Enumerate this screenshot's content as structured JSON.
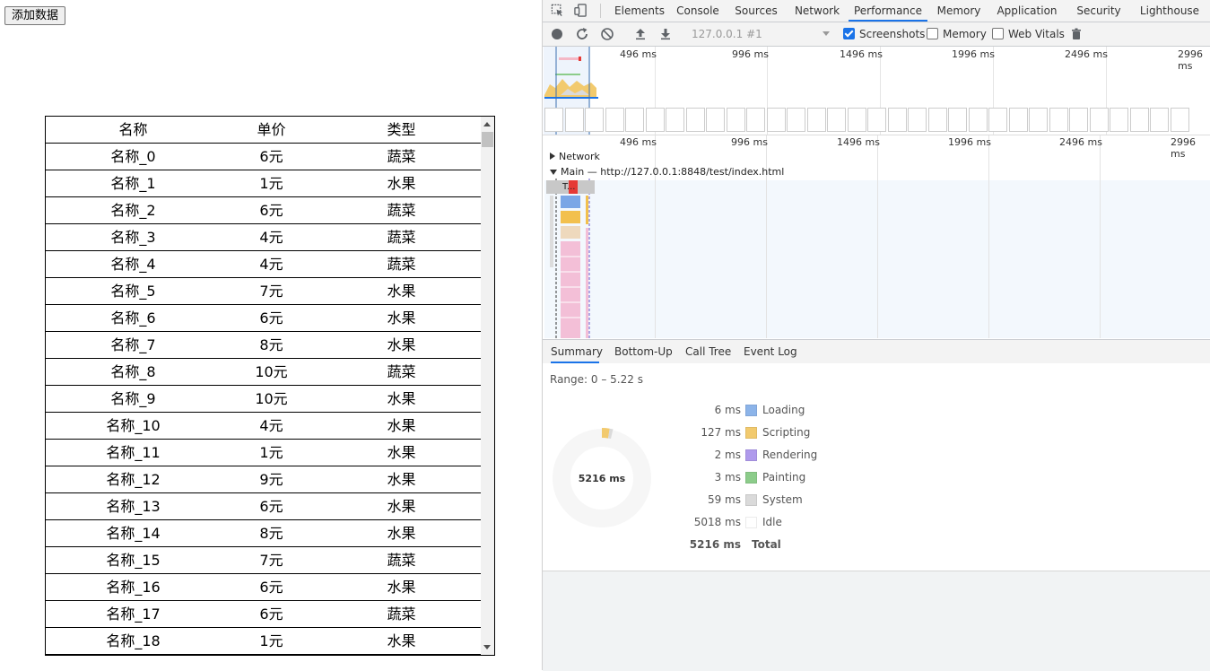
{
  "page": {
    "add_button": "添加数据"
  },
  "table": {
    "headers": [
      "名称",
      "单价",
      "类型"
    ],
    "rows": [
      [
        "名称_0",
        "6元",
        "蔬菜"
      ],
      [
        "名称_1",
        "1元",
        "水果"
      ],
      [
        "名称_2",
        "6元",
        "蔬菜"
      ],
      [
        "名称_3",
        "4元",
        "蔬菜"
      ],
      [
        "名称_4",
        "4元",
        "蔬菜"
      ],
      [
        "名称_5",
        "7元",
        "水果"
      ],
      [
        "名称_6",
        "6元",
        "水果"
      ],
      [
        "名称_7",
        "8元",
        "水果"
      ],
      [
        "名称_8",
        "10元",
        "蔬菜"
      ],
      [
        "名称_9",
        "10元",
        "水果"
      ],
      [
        "名称_10",
        "4元",
        "水果"
      ],
      [
        "名称_11",
        "1元",
        "水果"
      ],
      [
        "名称_12",
        "9元",
        "水果"
      ],
      [
        "名称_13",
        "6元",
        "水果"
      ],
      [
        "名称_14",
        "8元",
        "水果"
      ],
      [
        "名称_15",
        "7元",
        "蔬菜"
      ],
      [
        "名称_16",
        "6元",
        "水果"
      ],
      [
        "名称_17",
        "6元",
        "蔬菜"
      ],
      [
        "名称_18",
        "1元",
        "水果"
      ]
    ]
  },
  "devtools": {
    "tabs": [
      "Elements",
      "Console",
      "Sources",
      "Network",
      "Performance",
      "Memory",
      "Application",
      "Security",
      "Lighthouse"
    ],
    "active_tab": "Performance",
    "toolbar": {
      "recording_select": "127.0.0.1 #1",
      "screenshots_label": "Screenshots",
      "screenshots_checked": true,
      "memory_label": "Memory",
      "memory_checked": false,
      "webvitals_label": "Web Vitals",
      "webvitals_checked": false
    },
    "overview_ticks": [
      "496 ms",
      "996 ms",
      "1496 ms",
      "1996 ms",
      "2496 ms",
      "2996 ms"
    ],
    "timeline_ticks": [
      "496 ms",
      "996 ms",
      "1496 ms",
      "1996 ms",
      "2496 ms",
      "2996 ms"
    ],
    "tracks": {
      "network_label": "Network",
      "main_label": "Main",
      "main_url": "— http://127.0.0.1:8848/test/index.html",
      "task_label": "T..."
    },
    "bottom_tabs": [
      "Summary",
      "Bottom-Up",
      "Call Tree",
      "Event Log"
    ],
    "active_bottom_tab": "Summary",
    "summary": {
      "range": "Range: 0 – 5.22 s",
      "total_center": "5216 ms",
      "items": [
        {
          "value": "6 ms",
          "label": "Loading",
          "color": "#8cb4e9"
        },
        {
          "value": "127 ms",
          "label": "Scripting",
          "color": "#f2ca6e"
        },
        {
          "value": "2 ms",
          "label": "Rendering",
          "color": "#af9aec"
        },
        {
          "value": "3 ms",
          "label": "Painting",
          "color": "#8ccc8a"
        },
        {
          "value": "59 ms",
          "label": "System",
          "color": "#dadada"
        },
        {
          "value": "5018 ms",
          "label": "Idle",
          "color": "#ffffff"
        }
      ],
      "total": {
        "value": "5216 ms",
        "label": "Total"
      }
    }
  }
}
